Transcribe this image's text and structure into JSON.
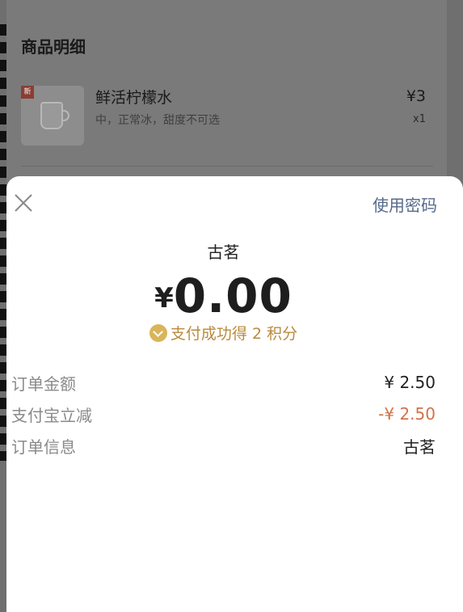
{
  "order_detail": {
    "title": "商品明细",
    "item": {
      "badge": "新",
      "name": "鲜活柠檬水",
      "options": "中，正常冰，甜度不可选",
      "price": "¥3",
      "quantity": "x1"
    }
  },
  "payment": {
    "password_link": "使用密码",
    "merchant": "古茗",
    "currency": "¥",
    "amount": "0.00",
    "points_text": "支付成功得 2 积分",
    "rows": [
      {
        "label": "订单金额",
        "value": "¥ 2.50"
      },
      {
        "label": "支付宝立减",
        "value": "-¥ 2.50"
      },
      {
        "label": "订单信息",
        "value": "古茗"
      }
    ],
    "colors": {
      "discount": "#d0734a",
      "link": "#566a8a",
      "points": "#b98a3e"
    }
  }
}
